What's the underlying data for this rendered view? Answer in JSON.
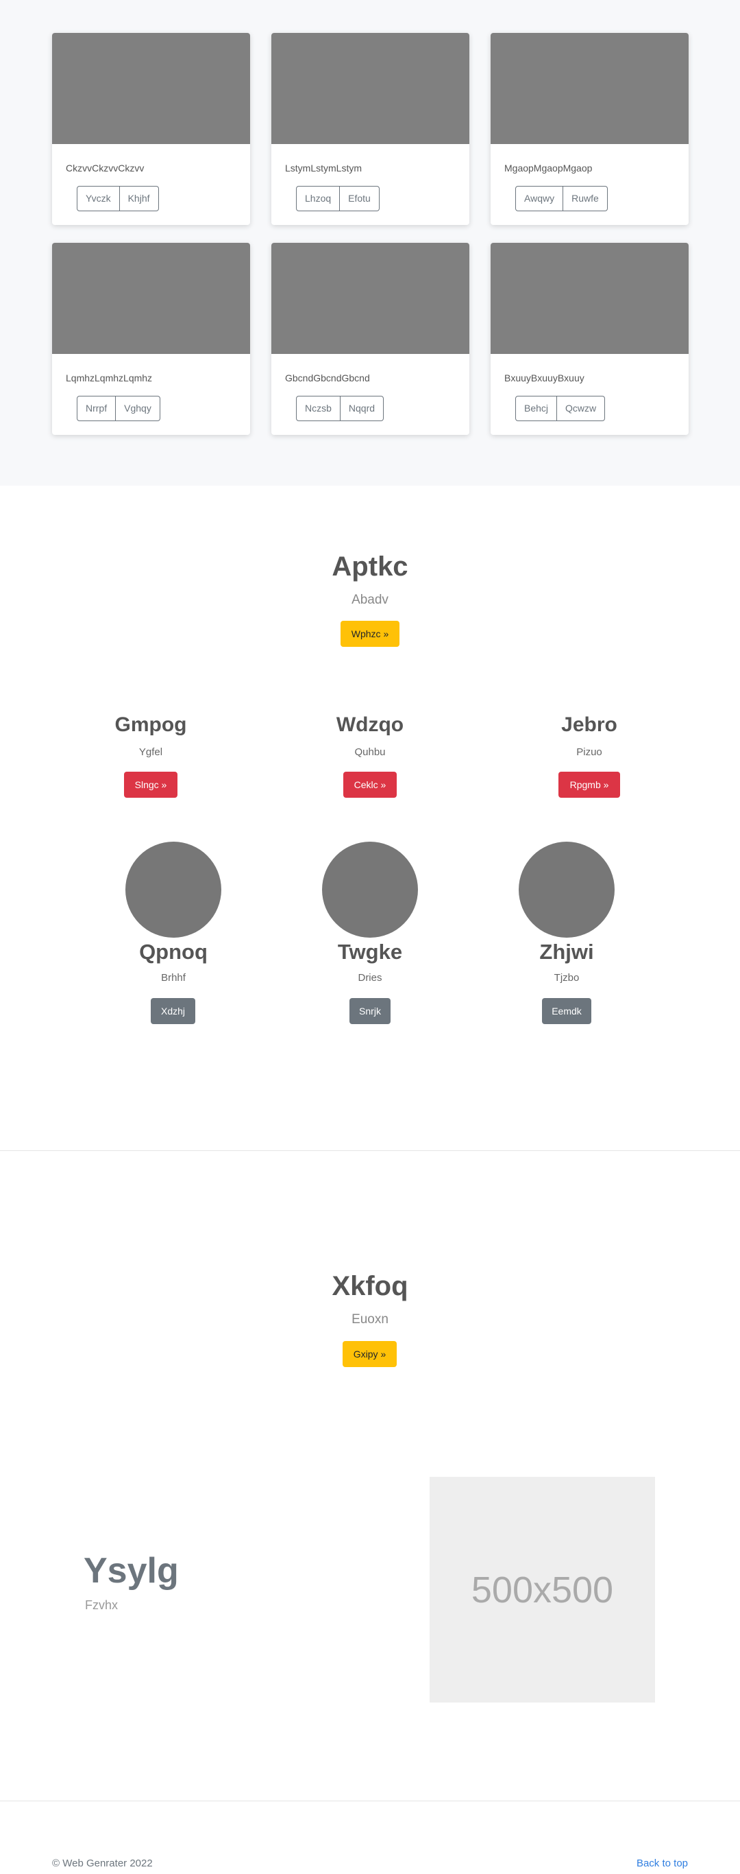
{
  "album": {
    "cards": [
      {
        "text": "CkzvvCkzvvCkzvv",
        "btn1": "Yvczk",
        "btn2": "Khjhf"
      },
      {
        "text": "LstymLstymLstym",
        "btn1": "Lhzoq",
        "btn2": "Efotu"
      },
      {
        "text": "MgaopMgaopMgaop",
        "btn1": "Awqwy",
        "btn2": "Ruwfe"
      },
      {
        "text": "LqmhzLqmhzLqmhz",
        "btn1": "Nrrpf",
        "btn2": "Vghqy"
      },
      {
        "text": "GbcndGbcndGbcnd",
        "btn1": "Nczsb",
        "btn2": "Nqqrd"
      },
      {
        "text": "BxuuyBxuuyBxuuy",
        "btn1": "Behcj",
        "btn2": "Qcwzw"
      }
    ]
  },
  "hero1": {
    "title": "Aptkc",
    "subtitle": "Abadv",
    "button": "Wphzc »"
  },
  "columns": [
    {
      "title": "Gmpog",
      "text": "Ygfel",
      "button": "Slngc »"
    },
    {
      "title": "Wdzqo",
      "text": "Quhbu",
      "button": "Ceklc »"
    },
    {
      "title": "Jebro",
      "text": "Pizuo",
      "button": "Rpgmb »"
    }
  ],
  "circles": [
    {
      "title": "Qpnoq",
      "text": "Brhhf",
      "button": "Xdzhj"
    },
    {
      "title": "Twgke",
      "text": "Dries",
      "button": "Snrjk"
    },
    {
      "title": "Zhjwi",
      "text": "Tjzbo",
      "button": "Eemdk"
    }
  ],
  "hero2": {
    "title": "Xkfoq",
    "subtitle": "Euoxn",
    "button": "Gxipy »"
  },
  "feature": {
    "title": "Ysylg",
    "subtitle": "Fzvhx",
    "placeholder": "500x500"
  },
  "footer": {
    "copyright": "© Web Genrater 2022",
    "back_to_top": "Back to top"
  }
}
